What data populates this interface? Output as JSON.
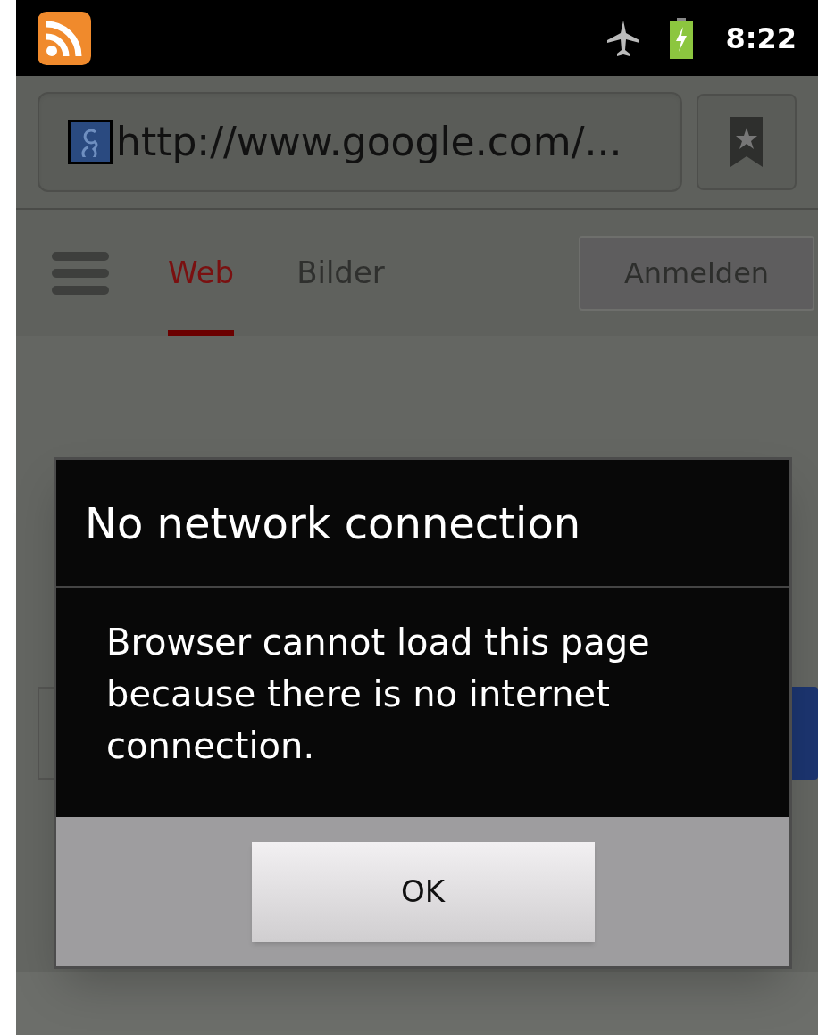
{
  "status_bar": {
    "time": "8:22"
  },
  "address_bar": {
    "url": "http://www.google.com/..."
  },
  "nav": {
    "tabs": [
      {
        "label": "Web",
        "selected": true
      },
      {
        "label": "Bilder",
        "selected": false
      }
    ],
    "sign_in_button": "Anmelden"
  },
  "dialog": {
    "title": "No network connection",
    "message": "Browser cannot load this page because there is no internet connection.",
    "buttons": [
      "OK"
    ]
  }
}
